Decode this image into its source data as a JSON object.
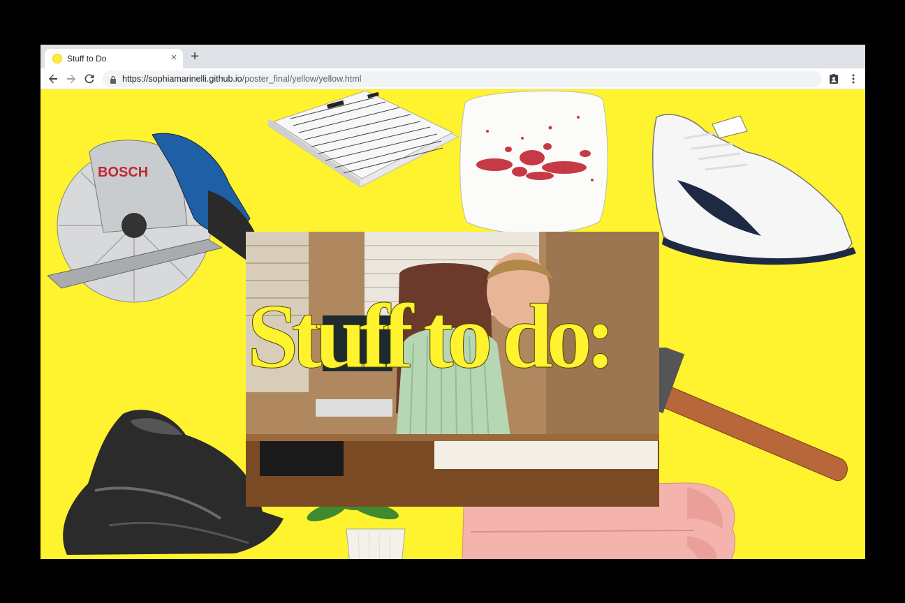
{
  "browser": {
    "tab": {
      "title": "Stuff to Do",
      "favicon": "yellow-dot-icon"
    },
    "new_tab_label": "+",
    "close_label": "×",
    "url_host": "https://sophiamarinelli.github.io",
    "url_path": "/poster_final/yellow/yellow.html",
    "icons": [
      "back-arrow-icon",
      "forward-arrow-icon",
      "reload-icon",
      "lock-icon",
      "extension-icon",
      "menu-dots-icon"
    ]
  },
  "page": {
    "background": "#fff22e",
    "headline": "Stuff to do:",
    "images": [
      "circular-saw",
      "tax-forms-stack",
      "stained-plate",
      "white-sneaker",
      "trash-bag",
      "potted-plant",
      "pink-towel",
      "hammer",
      "office-man-photo"
    ]
  }
}
